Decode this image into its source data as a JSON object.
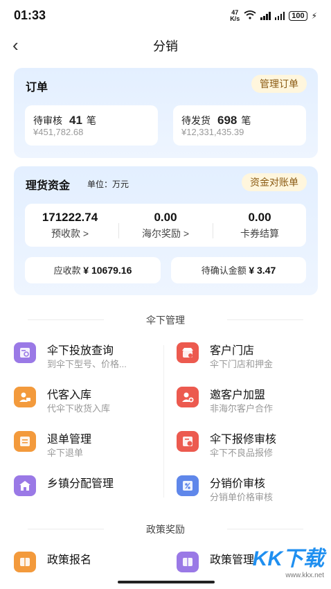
{
  "status": {
    "time": "01:33",
    "net_speed_top": "47",
    "net_speed_bottom": "K/s",
    "wifi_sup": "6",
    "battery": "100"
  },
  "header": {
    "title": "分销"
  },
  "orders": {
    "title": "订单",
    "manage_button": "管理订单",
    "pending_review": {
      "label": "待审核",
      "count": "41",
      "unit": "笔",
      "amount": "¥451,782.68"
    },
    "pending_ship": {
      "label": "待发货",
      "count": "698",
      "unit": "笔",
      "amount": "¥12,331,435.39"
    }
  },
  "funds": {
    "title": "理货资金",
    "unit": "单位：万元",
    "statement_button": "资金对账单",
    "cols": [
      {
        "value": "171222.74",
        "label": "预收款 >"
      },
      {
        "value": "0.00",
        "label": "海尔奖励 >"
      },
      {
        "value": "0.00",
        "label": "卡券结算"
      }
    ],
    "receivable_label": "应收款",
    "receivable_value": "¥ 10679.16",
    "pending_confirm_label": "待确认金额",
    "pending_confirm_value": "¥ 3.47"
  },
  "umbrella_section": {
    "title": "伞下管理",
    "items": [
      {
        "title": "伞下投放查询",
        "sub": "到伞下型号、价格...",
        "icon": "search-doc-icon",
        "color": "#9a79e6"
      },
      {
        "title": "客户门店",
        "sub": "伞下门店和押金",
        "icon": "store-icon",
        "color": "#ec5a4f"
      },
      {
        "title": "代客入库",
        "sub": "代伞下收货入库",
        "icon": "user-box-icon",
        "color": "#f39a3c"
      },
      {
        "title": "邀客户加盟",
        "sub": "非海尔客户合作",
        "icon": "user-add-icon",
        "color": "#ec5a4f"
      },
      {
        "title": "退单管理",
        "sub": "伞下退单",
        "icon": "return-doc-icon",
        "color": "#f39a3c"
      },
      {
        "title": "伞下报修审核",
        "sub": "伞下不良品报修",
        "icon": "repair-doc-icon",
        "color": "#ec5a4f"
      },
      {
        "title": "乡镇分配管理",
        "sub": "",
        "icon": "house-icon",
        "color": "#9a79e6"
      },
      {
        "title": "分销价审核",
        "sub": "分销单价格审核",
        "icon": "price-doc-icon",
        "color": "#5f87ea"
      }
    ]
  },
  "policy_section": {
    "title": "政策奖励",
    "items": [
      {
        "title": "政策报名",
        "icon": "policy-signup-icon",
        "color": "#f39a3c"
      },
      {
        "title": "政策管理",
        "icon": "policy-manage-icon",
        "color": "#9a79e6"
      }
    ]
  },
  "watermark": {
    "text": "KK下载",
    "url": "www.kkx.net"
  }
}
